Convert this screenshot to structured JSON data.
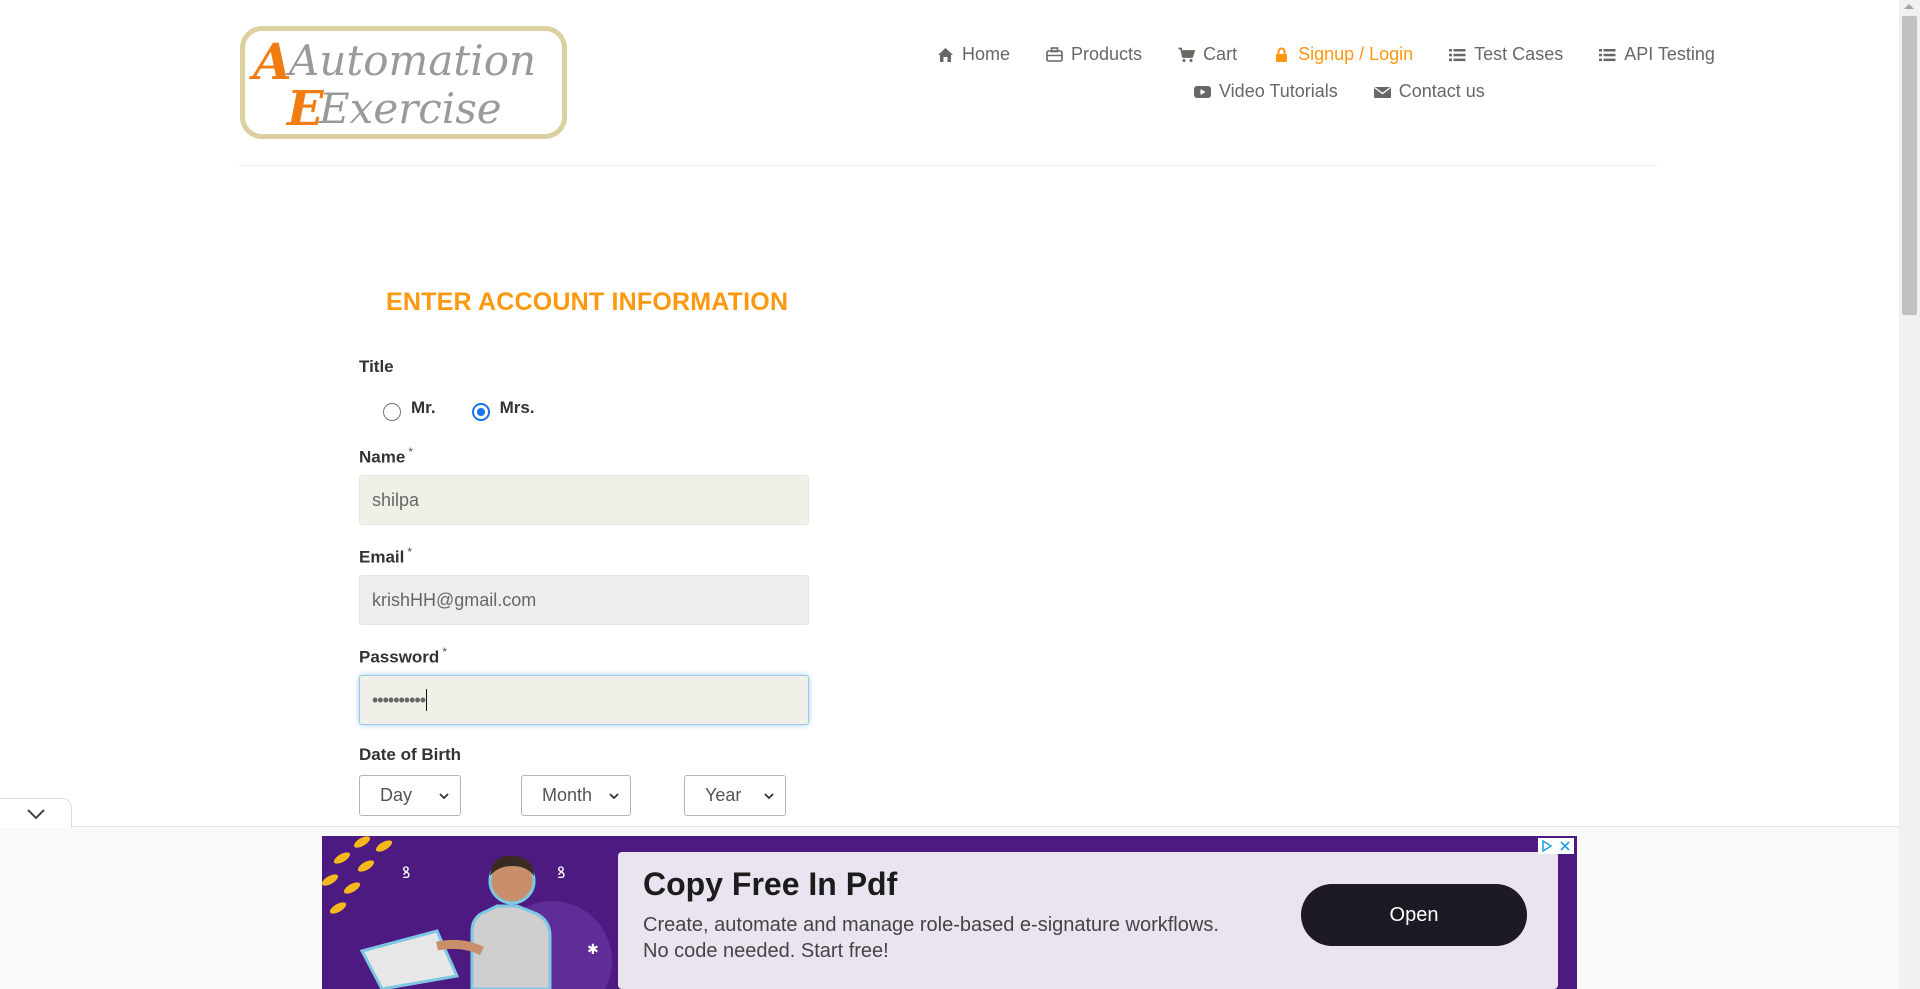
{
  "header": {
    "logo": {
      "text_line1": "Automation",
      "text_line2": "Exercise"
    },
    "nav": [
      {
        "label": "Home",
        "icon": "home-icon"
      },
      {
        "label": "Products",
        "icon": "briefcase-icon"
      },
      {
        "label": "Cart",
        "icon": "cart-icon"
      },
      {
        "label": "Signup / Login",
        "icon": "lock-icon",
        "active": true
      },
      {
        "label": "Test Cases",
        "icon": "list-icon"
      },
      {
        "label": "API Testing",
        "icon": "list-icon"
      },
      {
        "label": "Video Tutorials",
        "icon": "youtube-play-icon"
      },
      {
        "label": "Contact us",
        "icon": "envelope-icon"
      }
    ]
  },
  "form": {
    "title": "ENTER ACCOUNT INFORMATION",
    "title_label": "Title",
    "options": {
      "mr": "Mr.",
      "mrs": "Mrs.",
      "selected": "Mrs."
    },
    "name_label": "Name",
    "name_value": "shilpa",
    "email_label": "Email",
    "email_value": "krishHH@gmail.com",
    "password_label": "Password",
    "password_value": "••••••••••",
    "dob_label": "Date of Birth",
    "day": "Day",
    "month": "Month",
    "year": "Year",
    "required_mark": "*"
  },
  "ad": {
    "title": "Copy Free In Pdf",
    "desc_line1": "Create, automate and manage role-based e-signature workflows.",
    "desc_line2": "No code needed. Start free!",
    "cta": "Open"
  },
  "colors": {
    "accent": "#fe980f",
    "nav_text": "#696763",
    "ad_bg": "#4c1a80",
    "radio_checked": "#1a73e8"
  }
}
